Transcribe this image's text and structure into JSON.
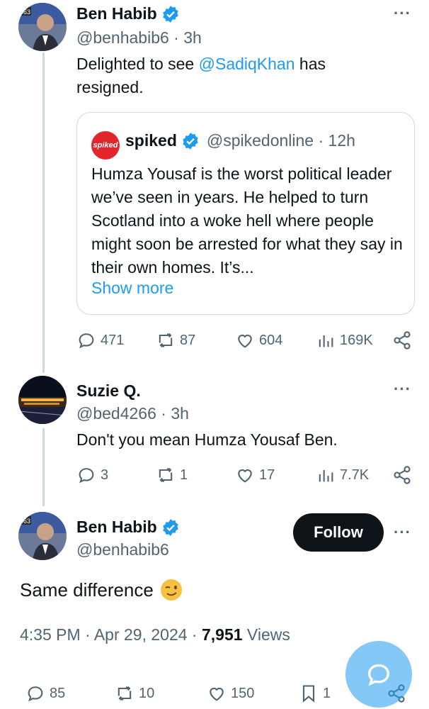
{
  "tweet1": {
    "avatar_badge": "863",
    "name": "Ben Habib",
    "handle_time": "@benhabib6 · 3h",
    "text_before": "Delighted to see ",
    "mention": "@SadiqKhan",
    "text_after": " has resigned.",
    "more": "···",
    "quote": {
      "logo": "spiked",
      "name": "spiked",
      "handle_time": "@spikedonline · 12h",
      "text": "Humza Yousaf is the worst political leader we’ve seen in years. He helped to turn Scotland into a woke hell where people might soon be arrested for what they say in their own homes. It’s...",
      "show_more": "Show more"
    },
    "stats": {
      "replies": "471",
      "reposts": "87",
      "likes": "604",
      "views": "169K"
    }
  },
  "tweet2": {
    "name": "Suzie Q.",
    "handle_time": "@bed4266 · 3h",
    "text": "Don't you mean Humza Yousaf Ben.",
    "more": "···",
    "stats": {
      "replies": "3",
      "reposts": "1",
      "likes": "17",
      "views": "7.7K"
    }
  },
  "tweet3": {
    "avatar_badge": "863",
    "name": "Ben Habib",
    "handle": "@benhabib6",
    "follow_label": "Follow",
    "more": "···",
    "text": "Same difference",
    "time": "4:35 PM · Apr 29, 2024 · ",
    "views_count": "7,951",
    "views_label": " Views",
    "stats": {
      "replies": "85",
      "reposts": "10",
      "likes": "150",
      "bookmarks": "1"
    }
  },
  "colors": {
    "accent": "#1d9bf0",
    "muted": "#536471",
    "text": "#0f1419",
    "spiked_red": "#e3262b"
  },
  "icons": [
    "verified-icon",
    "reply-icon",
    "repost-icon",
    "like-icon",
    "views-icon",
    "share-icon",
    "bookmark-icon",
    "wink-emoji-icon",
    "compose-message-icon"
  ]
}
